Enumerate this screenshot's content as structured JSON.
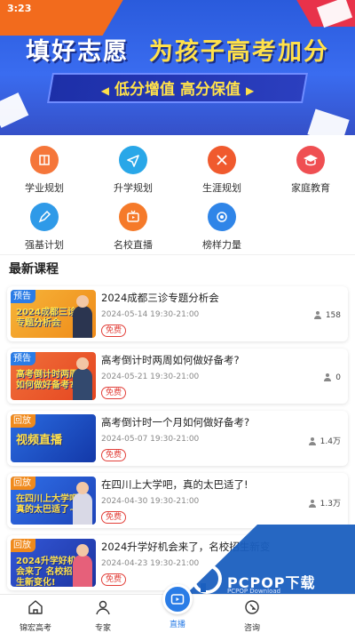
{
  "status": {
    "time": "3:23"
  },
  "banner": {
    "title_part1": "填好志愿",
    "title_part2": "为孩子高考加分",
    "subtitle": "低分增值  高分保值"
  },
  "grid": [
    {
      "label": "学业规划",
      "icon": "book-icon",
      "color": "#f5763a"
    },
    {
      "label": "升学规划",
      "icon": "send-icon",
      "color": "#29a7e8"
    },
    {
      "label": "生涯规划",
      "icon": "tools-icon",
      "color": "#f05a2e"
    },
    {
      "label": "家庭教育",
      "icon": "graduation-cap-icon",
      "color": "#ef4f52"
    },
    {
      "label": "强基计划",
      "icon": "pencil-icon",
      "color": "#2f9ae8"
    },
    {
      "label": "名校直播",
      "icon": "tv-icon",
      "color": "#f57a2a"
    },
    {
      "label": "榜样力量",
      "icon": "medal-icon",
      "color": "#2f85e8"
    }
  ],
  "section": {
    "title": "最新课程"
  },
  "courses": [
    {
      "tag": "预告",
      "type": "preview",
      "thumb_text": "2024成都三诊 专题分析会",
      "title": "2024成都三诊专题分析会",
      "time": "2024-05-14 19:30-21:00",
      "price": "免费",
      "count": "158",
      "thumb_color": "#f29a1e"
    },
    {
      "tag": "预告",
      "type": "preview",
      "thumb_text": "高考倒计时两周 如何做好备考?",
      "title": "高考倒计时两周如何做好备考?",
      "time": "2024-05-21 19:30-21:00",
      "price": "免费",
      "count": "0",
      "thumb_color": "#e8542a"
    },
    {
      "tag": "回放",
      "type": "review",
      "thumb_text": "视频直播",
      "title": "高考倒计时一个月如何做好备考?",
      "time": "2024-05-07 19:30-21:00",
      "price": "免费",
      "count": "1.4万",
      "thumb_color": "#1c4fc4"
    },
    {
      "tag": "回放",
      "type": "review",
      "thumb_text": "在四川上大学吧 真的太巴适了~",
      "title": "在四川上大学吧，真的太巴适了!",
      "time": "2024-04-30 19:30-21:00",
      "price": "免费",
      "count": "1.3万",
      "thumb_color": "#2255d0"
    },
    {
      "tag": "回放",
      "type": "review",
      "thumb_text": "2024升学好机会来了 名校招生新变化!",
      "title": "2024升学好机会来了，名校招生新变",
      "time": "2024-04-23 19:30-21:00",
      "price": "免费",
      "count": "",
      "thumb_color": "#2a4fc0"
    }
  ],
  "bottom_nav": [
    {
      "label": "锦宏高考",
      "icon": "home-icon"
    },
    {
      "label": "专家",
      "icon": "user-icon"
    },
    {
      "label": "直播",
      "icon": "play-icon"
    },
    {
      "label": "",
      "icon": ""
    },
    {
      "label": "咨询",
      "icon": "chat-icon"
    }
  ],
  "watermark": {
    "brand": "PCPOP下载",
    "sub": "PCPOP Download"
  },
  "colors": {
    "accent": "#2a7ce6",
    "free": "#e2403a"
  }
}
